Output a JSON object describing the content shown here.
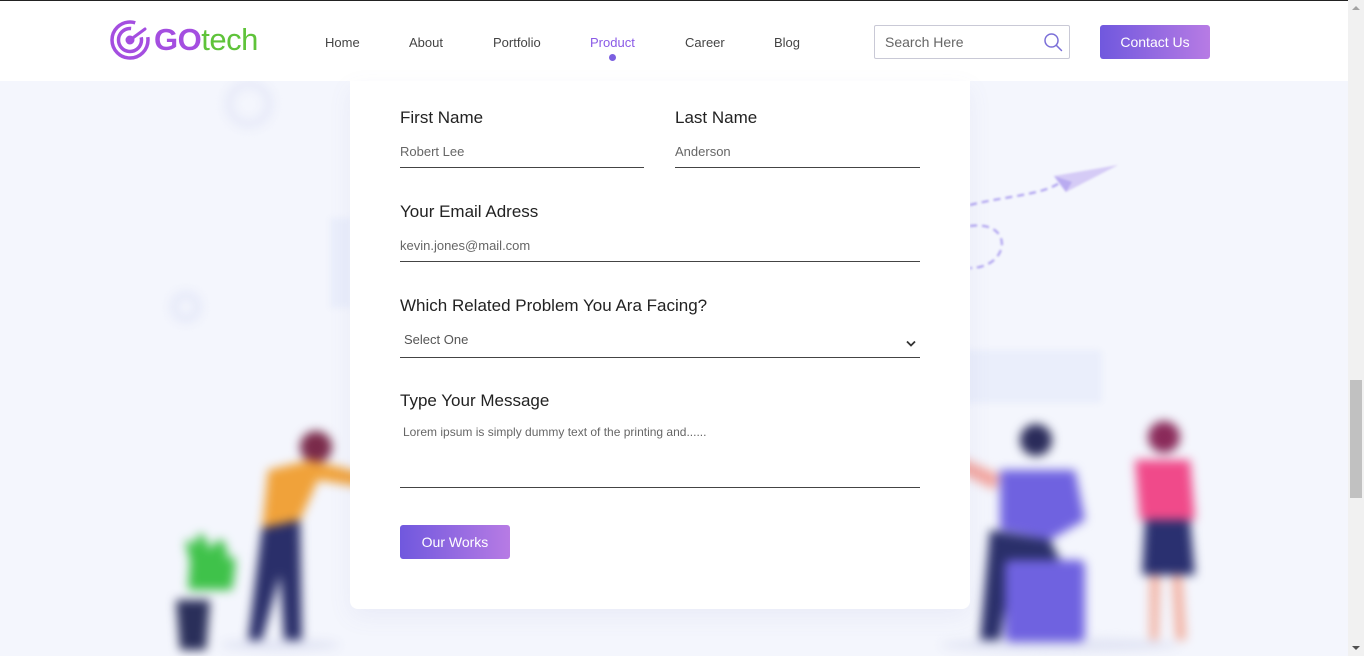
{
  "header": {
    "logo": {
      "go": "GO",
      "tech": "tech",
      "icon": "target-swirl-logo-icon"
    },
    "nav": [
      {
        "label": "Home",
        "active": false
      },
      {
        "label": "About",
        "active": false
      },
      {
        "label": "Portfolio",
        "active": false
      },
      {
        "label": "Product",
        "active": true
      },
      {
        "label": "Career",
        "active": false
      },
      {
        "label": "Blog",
        "active": false
      }
    ],
    "search": {
      "placeholder": "Search Here",
      "icon": "search-icon"
    },
    "contact_label": "Contact Us"
  },
  "form": {
    "first_name": {
      "label": "First Name",
      "value": "Robert Lee"
    },
    "last_name": {
      "label": "Last Name",
      "value": "Anderson"
    },
    "email": {
      "label": "Your Email Adress",
      "value": "kevin.jones@mail.com"
    },
    "problem": {
      "label": "Which Related Problem You Ara Facing?",
      "selected": "Select One",
      "icon": "chevron-down-icon"
    },
    "message": {
      "label": "Type Your Message",
      "value": "Lorem ipsum is simply dummy text of the printing and......"
    },
    "submit_label": "Our Works"
  },
  "colors": {
    "accent": "#7b5fe0",
    "gradient_start": "#7058de",
    "gradient_end": "#b77be4",
    "logo_purple": "#a44ee0",
    "logo_green": "#5fc33a"
  }
}
